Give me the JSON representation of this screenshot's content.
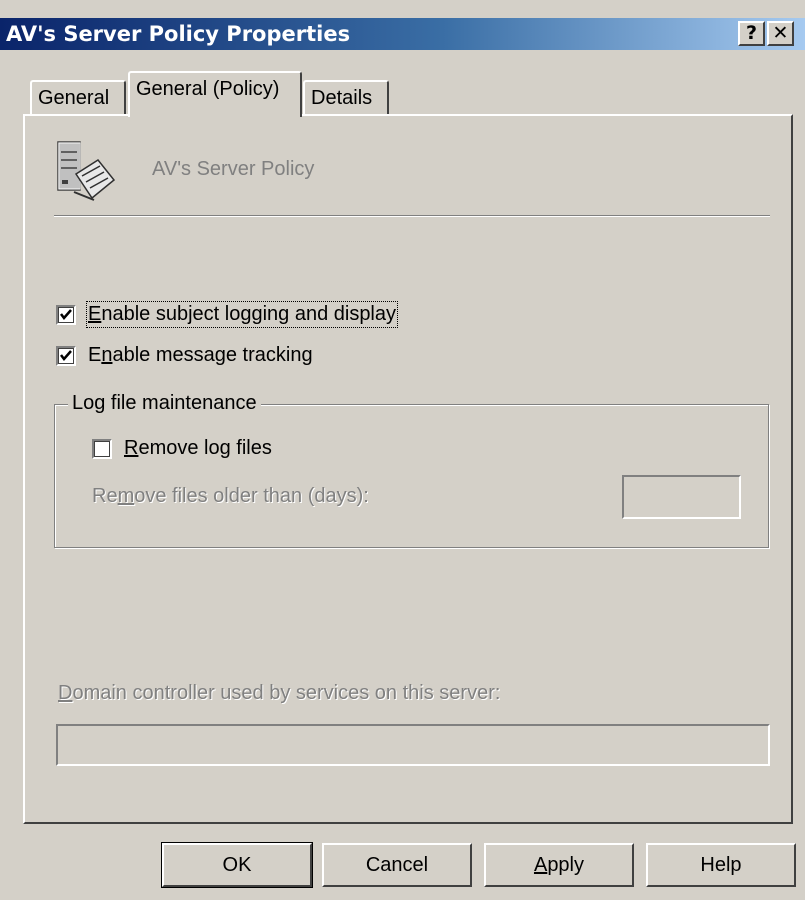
{
  "window": {
    "title": "AV's Server Policy Properties",
    "help_button": "?",
    "close_button": "✕"
  },
  "tabs": [
    {
      "label": "General",
      "selected": false
    },
    {
      "label": "General (Policy)",
      "selected": true
    },
    {
      "label": "Details",
      "selected": false
    }
  ],
  "header": {
    "icon": "server-policy-icon",
    "policy_name": "AV's Server Policy"
  },
  "options": {
    "subject_logging": {
      "label_prefix": "",
      "mnemonic": "E",
      "label_rest": "nable subject logging and display",
      "checked": true
    },
    "message_tracking": {
      "label_prefix": "E",
      "mnemonic": "n",
      "label_rest": "able message tracking",
      "checked": true
    }
  },
  "log_maintenance": {
    "group_title": "Log file maintenance",
    "remove_log_files": {
      "mnemonic": "R",
      "label_rest": "emove log files",
      "checked": false
    },
    "older_than": {
      "label_prefix": "Re",
      "mnemonic": "m",
      "label_rest": "ove files older than (days):",
      "value": ""
    }
  },
  "domain_controller": {
    "mnemonic": "D",
    "label_rest": "omain controller used by services on this server:",
    "value": ""
  },
  "buttons": {
    "ok": "OK",
    "cancel": "Cancel",
    "apply_mnemonic": "A",
    "apply_rest": "pply",
    "help": "Help"
  },
  "colors": {
    "face": "#d4d0c8",
    "title_start": "#0a246a",
    "title_end": "#a6caf0",
    "disabled_text": "#808080"
  }
}
